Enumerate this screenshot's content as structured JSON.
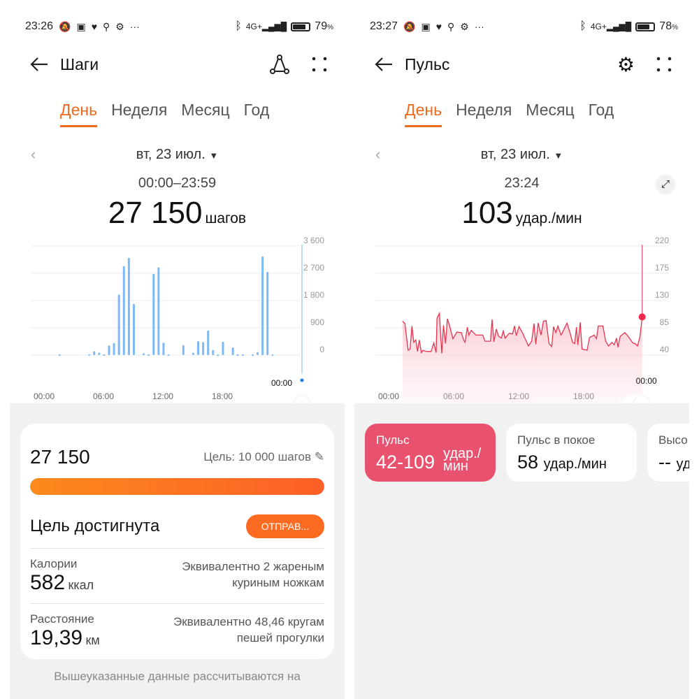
{
  "left": {
    "status": {
      "time": "23:26",
      "battery": "79",
      "battery_unit": "%",
      "battery_level": 0.79
    },
    "header": {
      "title": "Шаги"
    },
    "tabs": [
      {
        "label": "День",
        "active": true
      },
      {
        "label": "Неделя"
      },
      {
        "label": "Месяц"
      },
      {
        "label": "Год"
      }
    ],
    "date": "вт, 23 июл.",
    "range": "00:00–23:59",
    "total": "27 150",
    "unit": "шагов",
    "chart_data": {
      "type": "bar",
      "x_ticks": [
        "00:00",
        "06:00",
        "12:00",
        "18:00"
      ],
      "y_ticks": [
        "3 600",
        "2 700",
        "1 800",
        "900",
        "0"
      ],
      "ylim": [
        0,
        3600
      ],
      "cursor_label": "00:00",
      "color": "#7db9f5",
      "bars": [
        [
          "01:00",
          20
        ],
        [
          "04:00",
          30
        ],
        [
          "04:30",
          130
        ],
        [
          "05:00",
          80
        ],
        [
          "05:30",
          20
        ],
        [
          "06:00",
          320
        ],
        [
          "06:30",
          400
        ],
        [
          "07:00",
          2000
        ],
        [
          "07:30",
          2940
        ],
        [
          "08:00",
          3210
        ],
        [
          "08:30",
          1690
        ],
        [
          "09:30",
          60
        ],
        [
          "10:00",
          20
        ],
        [
          "10:30",
          2680
        ],
        [
          "11:00",
          2900
        ],
        [
          "11:30",
          410
        ],
        [
          "12:00",
          20
        ],
        [
          "13:30",
          330
        ],
        [
          "14:30",
          80
        ],
        [
          "15:00",
          460
        ],
        [
          "15:30",
          430
        ],
        [
          "16:00",
          810
        ],
        [
          "16:30",
          170
        ],
        [
          "17:00",
          20
        ],
        [
          "17:30",
          440
        ],
        [
          "18:30",
          250
        ],
        [
          "19:00",
          20
        ],
        [
          "19:30",
          20
        ],
        [
          "20:30",
          20
        ],
        [
          "21:00",
          100
        ],
        [
          "21:30",
          3260
        ],
        [
          "22:00",
          2750
        ],
        [
          "22:30",
          20
        ]
      ]
    },
    "card": {
      "steps": "27 150",
      "goal": "Цель: 10 000 шагов",
      "progress": 1.0,
      "achieved": "Цель достигнута",
      "send": "ОТПРАВ...",
      "calories_label": "Калории",
      "calories": "582",
      "calories_unit": "ккал",
      "calories_eq": "Эквивалентно 2 жареным куриным ножкам",
      "distance_label": "Расстояние",
      "distance": "19,39",
      "distance_unit": "км",
      "distance_eq": "Эквивалентно 48,46 кругам пешей прогулки"
    },
    "footer": "Вышеуказанные данные рассчитываются на"
  },
  "right": {
    "status": {
      "time": "23:27",
      "battery": "78",
      "battery_unit": "%",
      "battery_level": 0.78
    },
    "header": {
      "title": "Пульс"
    },
    "tabs": [
      {
        "label": "День",
        "active": true
      },
      {
        "label": "Неделя"
      },
      {
        "label": "Месяц"
      },
      {
        "label": "Год"
      }
    ],
    "date": "вт, 23 июл.",
    "time": "23:24",
    "value": "103",
    "unit": "удар./мин",
    "chart_data": {
      "type": "area",
      "x_ticks": [
        "00:00",
        "06:00",
        "12:00",
        "18:00"
      ],
      "y_ticks": [
        "220",
        "175",
        "130",
        "85",
        "40"
      ],
      "ylim": [
        40,
        220
      ],
      "cursor_label": "00:00",
      "color": "#e8334f",
      "selected": [
        "23:24",
        103
      ],
      "points": [
        [
          "01:17",
          96
        ],
        [
          "01:30",
          92
        ],
        [
          "01:48",
          48
        ],
        [
          "01:59",
          50
        ],
        [
          "02:09",
          88
        ],
        [
          "02:19",
          61
        ],
        [
          "02:30",
          65
        ],
        [
          "02:40",
          46
        ],
        [
          "02:50",
          65
        ],
        [
          "03:01",
          44
        ],
        [
          "03:11",
          48
        ],
        [
          "03:29",
          46
        ],
        [
          "03:55",
          46
        ],
        [
          "04:10",
          60
        ],
        [
          "04:23",
          44
        ],
        [
          "04:28",
          101
        ],
        [
          "04:41",
          109
        ],
        [
          "04:54",
          43
        ],
        [
          "05:04",
          89
        ],
        [
          "05:15",
          59
        ],
        [
          "05:25",
          100
        ],
        [
          "05:38",
          88
        ],
        [
          "05:56",
          67
        ],
        [
          "06:17",
          78
        ],
        [
          "06:43",
          77
        ],
        [
          "06:55",
          65
        ],
        [
          "07:03",
          61
        ],
        [
          "07:16",
          86
        ],
        [
          "07:24",
          73
        ],
        [
          "07:37",
          81
        ],
        [
          "08:03",
          73
        ],
        [
          "08:26",
          73
        ],
        [
          "08:41",
          73
        ],
        [
          "08:54",
          63
        ],
        [
          "09:24",
          63
        ],
        [
          "09:33",
          99
        ],
        [
          "09:43",
          62
        ],
        [
          "09:56",
          83
        ],
        [
          "10:09",
          71
        ],
        [
          "10:24",
          68
        ],
        [
          "10:35",
          80
        ],
        [
          "10:45",
          68
        ],
        [
          "11:08",
          76
        ],
        [
          "11:26",
          75
        ],
        [
          "11:37",
          88
        ],
        [
          "11:47",
          72
        ],
        [
          "12:02",
          87
        ],
        [
          "12:21",
          77
        ],
        [
          "12:54",
          55
        ],
        [
          "13:12",
          63
        ],
        [
          "13:25",
          92
        ],
        [
          "13:35",
          58
        ],
        [
          "13:48",
          93
        ],
        [
          "14:04",
          73
        ],
        [
          "14:17",
          96
        ],
        [
          "14:32",
          97
        ],
        [
          "14:48",
          59
        ],
        [
          "15:03",
          54
        ],
        [
          "15:13",
          87
        ],
        [
          "15:26",
          77
        ],
        [
          "15:37",
          88
        ],
        [
          "15:55",
          73
        ],
        [
          "16:10",
          82
        ],
        [
          "16:28",
          93
        ],
        [
          "16:44",
          77
        ],
        [
          "16:59",
          61
        ],
        [
          "17:10",
          59
        ],
        [
          "17:20",
          86
        ],
        [
          "17:28",
          57
        ],
        [
          "17:41",
          94
        ],
        [
          "17:51",
          50
        ],
        [
          "18:19",
          48
        ],
        [
          "18:32",
          69
        ],
        [
          "18:58",
          73
        ],
        [
          "19:11",
          67
        ],
        [
          "19:21",
          88
        ],
        [
          "19:47",
          88
        ],
        [
          "20:02",
          63
        ],
        [
          "20:18",
          55
        ],
        [
          "20:36",
          61
        ],
        [
          "20:49",
          57
        ],
        [
          "21:02",
          68
        ],
        [
          "21:10",
          53
        ],
        [
          "21:22",
          71
        ],
        [
          "21:48",
          77
        ],
        [
          "22:06",
          71
        ],
        [
          "22:32",
          60
        ],
        [
          "22:45",
          59
        ],
        [
          "22:58",
          55
        ],
        [
          "23:11",
          69
        ],
        [
          "23:21",
          94
        ],
        [
          "23:24",
          103
        ]
      ]
    },
    "pills": [
      {
        "label": "Пульс",
        "value": "42-109",
        "unit": "удар./мин",
        "active": true
      },
      {
        "label": "Пульс в покое",
        "value": "58",
        "unit": "удар./мин"
      },
      {
        "label": "Высо",
        "value": "--",
        "unit": "уд"
      }
    ]
  }
}
